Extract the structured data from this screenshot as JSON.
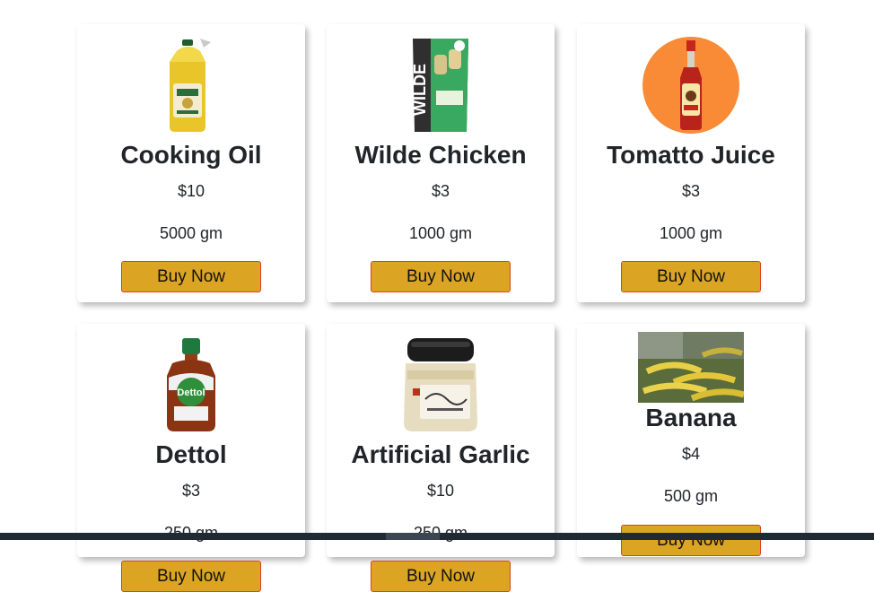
{
  "products": [
    {
      "title": "Cooking Oil",
      "price": "$10",
      "weight": "5000 gm",
      "button": "Buy Now",
      "icon": "cooking-oil-bottle"
    },
    {
      "title": "Wilde Chicken",
      "price": "$3",
      "weight": "1000 gm",
      "button": "Buy Now",
      "icon": "wilde-chips-bag",
      "package_text": "WILDE"
    },
    {
      "title": "Tomatto Juice",
      "price": "$3",
      "weight": "1000 gm",
      "button": "Buy Now",
      "icon": "hot-sauce-bottle"
    },
    {
      "title": "Dettol",
      "price": "$3",
      "weight": "250 gm",
      "button": "Buy Now",
      "icon": "dettol-bottle",
      "package_text": "Dettol"
    },
    {
      "title": "Artificial Garlic",
      "price": "$10",
      "weight": "250 gm",
      "button": "Buy Now",
      "icon": "garlic-jar"
    },
    {
      "title": "Banana",
      "price": "$4",
      "weight": "500 gm",
      "button": "Buy Now",
      "icon": "banana-photo"
    }
  ],
  "colors": {
    "button_bg": "#dba523",
    "button_border": "#d64520",
    "text": "#212529",
    "taskbar": "#1f2a33"
  }
}
